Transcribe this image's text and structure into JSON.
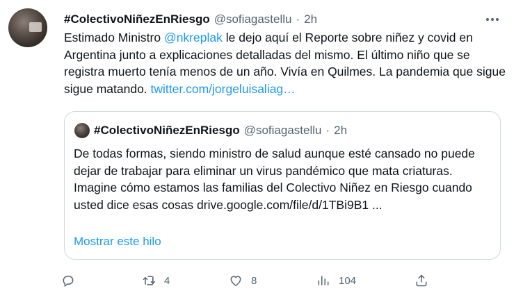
{
  "tweet": {
    "name": "#ColectivoNiñezEnRiesgo",
    "handle": "@sofiagastellu",
    "separator": "·",
    "time": "2h",
    "text_1": "Estimado Ministro ",
    "mention": "@nkreplak",
    "text_2": " le dejo aquí el Reporte sobre niñez y covid en Argentina junto a explicaciones detalladas del mismo. El último niño que se registra muerto tenía menos de un año. Vivía en Quilmes. La pandemia que sigue sigue matando.  ",
    "link": "twitter.com/jorgeluisaliag…"
  },
  "quote": {
    "name": "#ColectivoNiñezEnRiesgo",
    "handle": "@sofiagastellu",
    "separator": "·",
    "time": "2h",
    "text": "De todas formas, siendo ministro de salud aunque esté cansado no puede dejar de trabajar para eliminar un virus pandémico que mata criaturas. Imagine cómo estamos las familias del Colectivo Niñez en Riesgo cuando usted dice esas cosas drive.google.com/file/d/1TBi9B1 ...",
    "show_thread": "Mostrar este hilo"
  },
  "actions": {
    "reply_icon": "reply-icon",
    "retweet_icon": "retweet-icon",
    "retweets": "4",
    "like_icon": "heart-icon",
    "likes": "8",
    "views_icon": "views-icon",
    "views": "104",
    "share_icon": "share-icon"
  },
  "colors": {
    "accent": "#1d9bf0",
    "secondary_text": "#536471",
    "primary_text": "#0f1419",
    "border": "#cfd9de"
  }
}
